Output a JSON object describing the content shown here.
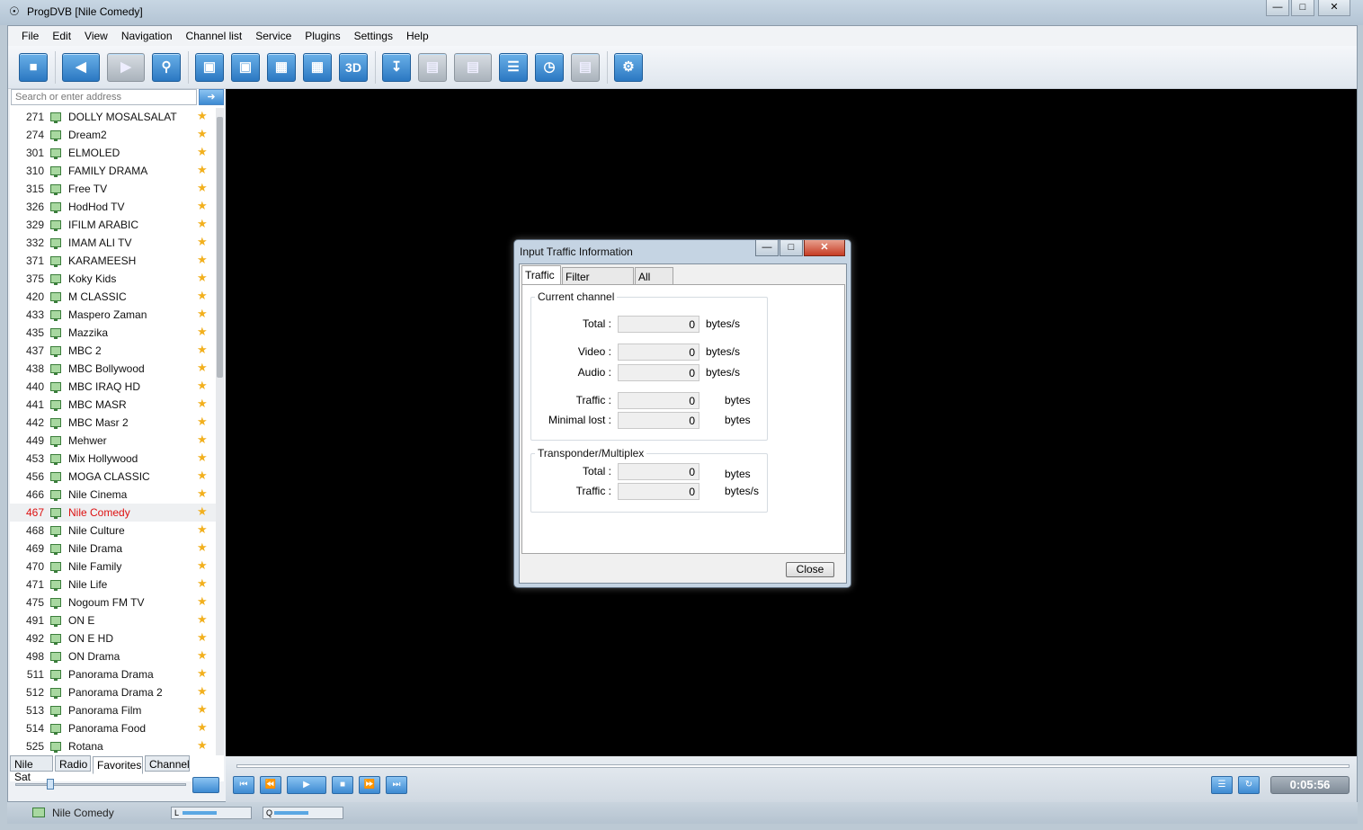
{
  "window": {
    "title": "ProgDVB [Nile Comedy]"
  },
  "menu": [
    "File",
    "Edit",
    "View",
    "Navigation",
    "Channel list",
    "Service",
    "Plugins",
    "Settings",
    "Help"
  ],
  "search": {
    "placeholder": "Search or enter address"
  },
  "channels": [
    {
      "num": "271",
      "name": "DOLLY MOSALSALAT"
    },
    {
      "num": "274",
      "name": "Dream2"
    },
    {
      "num": "301",
      "name": "ELMOLED"
    },
    {
      "num": "310",
      "name": "FAMILY DRAMA"
    },
    {
      "num": "315",
      "name": "Free TV"
    },
    {
      "num": "326",
      "name": "HodHod  TV"
    },
    {
      "num": "329",
      "name": "IFILM ARABIC"
    },
    {
      "num": "332",
      "name": "IMAM ALI TV"
    },
    {
      "num": "371",
      "name": "KARAMEESH"
    },
    {
      "num": "375",
      "name": "Koky Kids"
    },
    {
      "num": "420",
      "name": "M CLASSIC"
    },
    {
      "num": "433",
      "name": "Maspero Zaman"
    },
    {
      "num": "435",
      "name": "Mazzika"
    },
    {
      "num": "437",
      "name": "MBC 2"
    },
    {
      "num": "438",
      "name": "MBC Bollywood"
    },
    {
      "num": "440",
      "name": "MBC IRAQ HD"
    },
    {
      "num": "441",
      "name": "MBC MASR"
    },
    {
      "num": "442",
      "name": "MBC Masr 2"
    },
    {
      "num": "449",
      "name": "Mehwer"
    },
    {
      "num": "453",
      "name": "Mix Hollywood"
    },
    {
      "num": "456",
      "name": "MOGA CLASSIC"
    },
    {
      "num": "466",
      "name": "Nile Cinema"
    },
    {
      "num": "467",
      "name": "Nile Comedy",
      "selected": true
    },
    {
      "num": "468",
      "name": "Nile Culture"
    },
    {
      "num": "469",
      "name": "Nile Drama"
    },
    {
      "num": "470",
      "name": "Nile Family"
    },
    {
      "num": "471",
      "name": "Nile Life"
    },
    {
      "num": "475",
      "name": "Nogoum FM TV"
    },
    {
      "num": "491",
      "name": "ON  E"
    },
    {
      "num": "492",
      "name": "ON  E HD"
    },
    {
      "num": "498",
      "name": "ON Drama"
    },
    {
      "num": "511",
      "name": "Panorama Drama"
    },
    {
      "num": "512",
      "name": "Panorama Drama 2"
    },
    {
      "num": "513",
      "name": "Panorama Film"
    },
    {
      "num": "514",
      "name": "Panorama Food"
    },
    {
      "num": "525",
      "name": "Rotana"
    }
  ],
  "list_tabs": [
    "Nile Sat",
    "Radio",
    "Favorites",
    "Channel"
  ],
  "active_list_tab": "Favorites",
  "player": {
    "time": "0:05:56"
  },
  "status": {
    "channel": "Nile Comedy",
    "level_label": "L",
    "quality_label": "Q"
  },
  "dialog": {
    "title": "Input Traffic Information",
    "tabs": [
      "Traffic",
      "Filter Manager",
      "All PIDs"
    ],
    "active_tab": "Traffic",
    "current_channel": {
      "label": "Current channel",
      "total": {
        "label": "Total :",
        "value": "0",
        "unit": "bytes/s"
      },
      "video": {
        "label": "Video :",
        "value": "0",
        "unit": "bytes/s"
      },
      "audio": {
        "label": "Audio :",
        "value": "0",
        "unit": "bytes/s"
      },
      "traffic": {
        "label": "Traffic :",
        "value": "0",
        "unit": "bytes"
      },
      "minimal_lost": {
        "label": "Minimal lost :",
        "value": "0",
        "unit": "bytes"
      }
    },
    "transponder": {
      "label": "Transponder/Multiplex",
      "total": {
        "label": "Total :",
        "value": "0",
        "unit": "bytes"
      },
      "traffic": {
        "label": "Traffic :",
        "value": "0",
        "unit": "bytes/s"
      }
    },
    "close_label": "Close"
  },
  "colors": {
    "selected_channel": "#dd1111",
    "star": "#f2b01e",
    "accent": "#3d8ad2"
  }
}
